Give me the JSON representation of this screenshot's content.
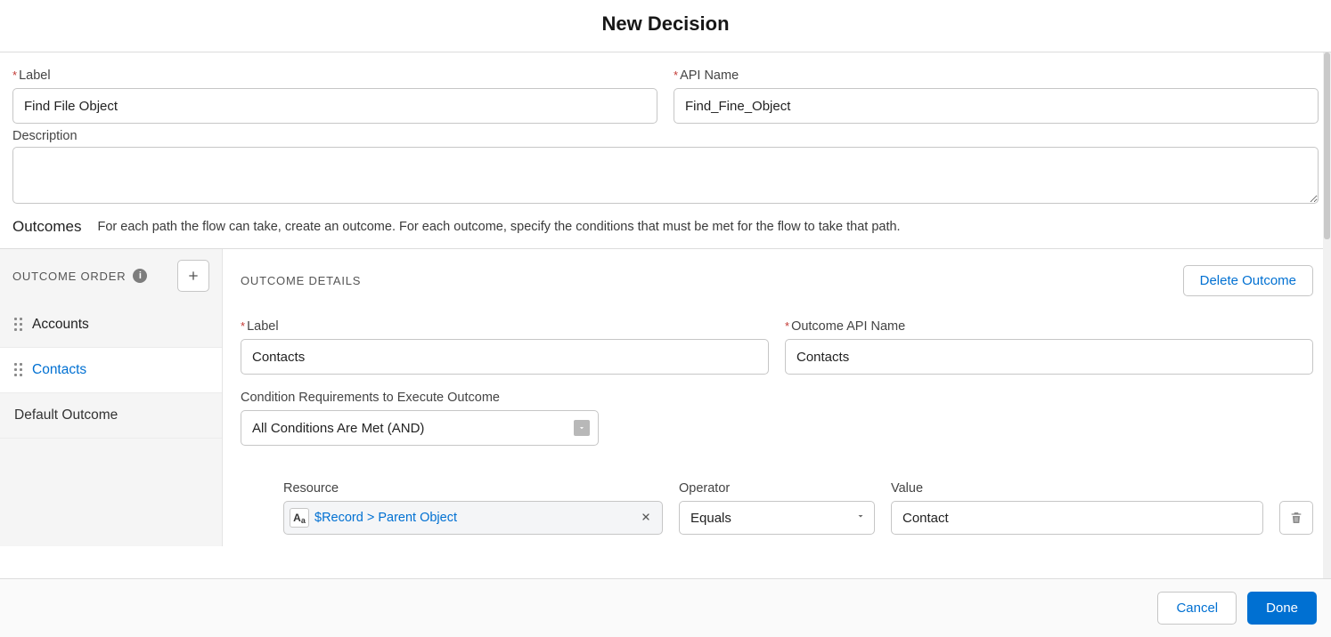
{
  "header": {
    "title": "New Decision"
  },
  "form": {
    "label_field": {
      "label": "Label",
      "value": "Find File Object"
    },
    "api_field": {
      "label": "API Name",
      "value": "Find_Fine_Object"
    },
    "desc_field": {
      "label": "Description",
      "value": ""
    }
  },
  "outcomes_bar": {
    "title": "Outcomes",
    "hint": "For each path the flow can take, create an outcome. For each outcome, specify the conditions that must be met for the flow to take that path."
  },
  "sidebar": {
    "header": "OUTCOME ORDER",
    "items": [
      {
        "label": "Accounts",
        "active": false
      },
      {
        "label": "Contacts",
        "active": true
      }
    ],
    "default_label": "Default Outcome"
  },
  "details": {
    "header": "OUTCOME DETAILS",
    "delete_label": "Delete Outcome",
    "label_field": {
      "label": "Label",
      "value": "Contacts"
    },
    "api_field": {
      "label": "Outcome API Name",
      "value": "Contacts"
    },
    "cond_req_label": "Condition Requirements to Execute Outcome",
    "cond_req_value": "All Conditions Are Met (AND)",
    "cond_row": {
      "resource_label": "Resource",
      "resource_pill": "$Record > Parent Object",
      "operator_label": "Operator",
      "operator_value": "Equals",
      "value_label": "Value",
      "value_value": "Contact"
    }
  },
  "footer": {
    "cancel": "Cancel",
    "done": "Done"
  }
}
